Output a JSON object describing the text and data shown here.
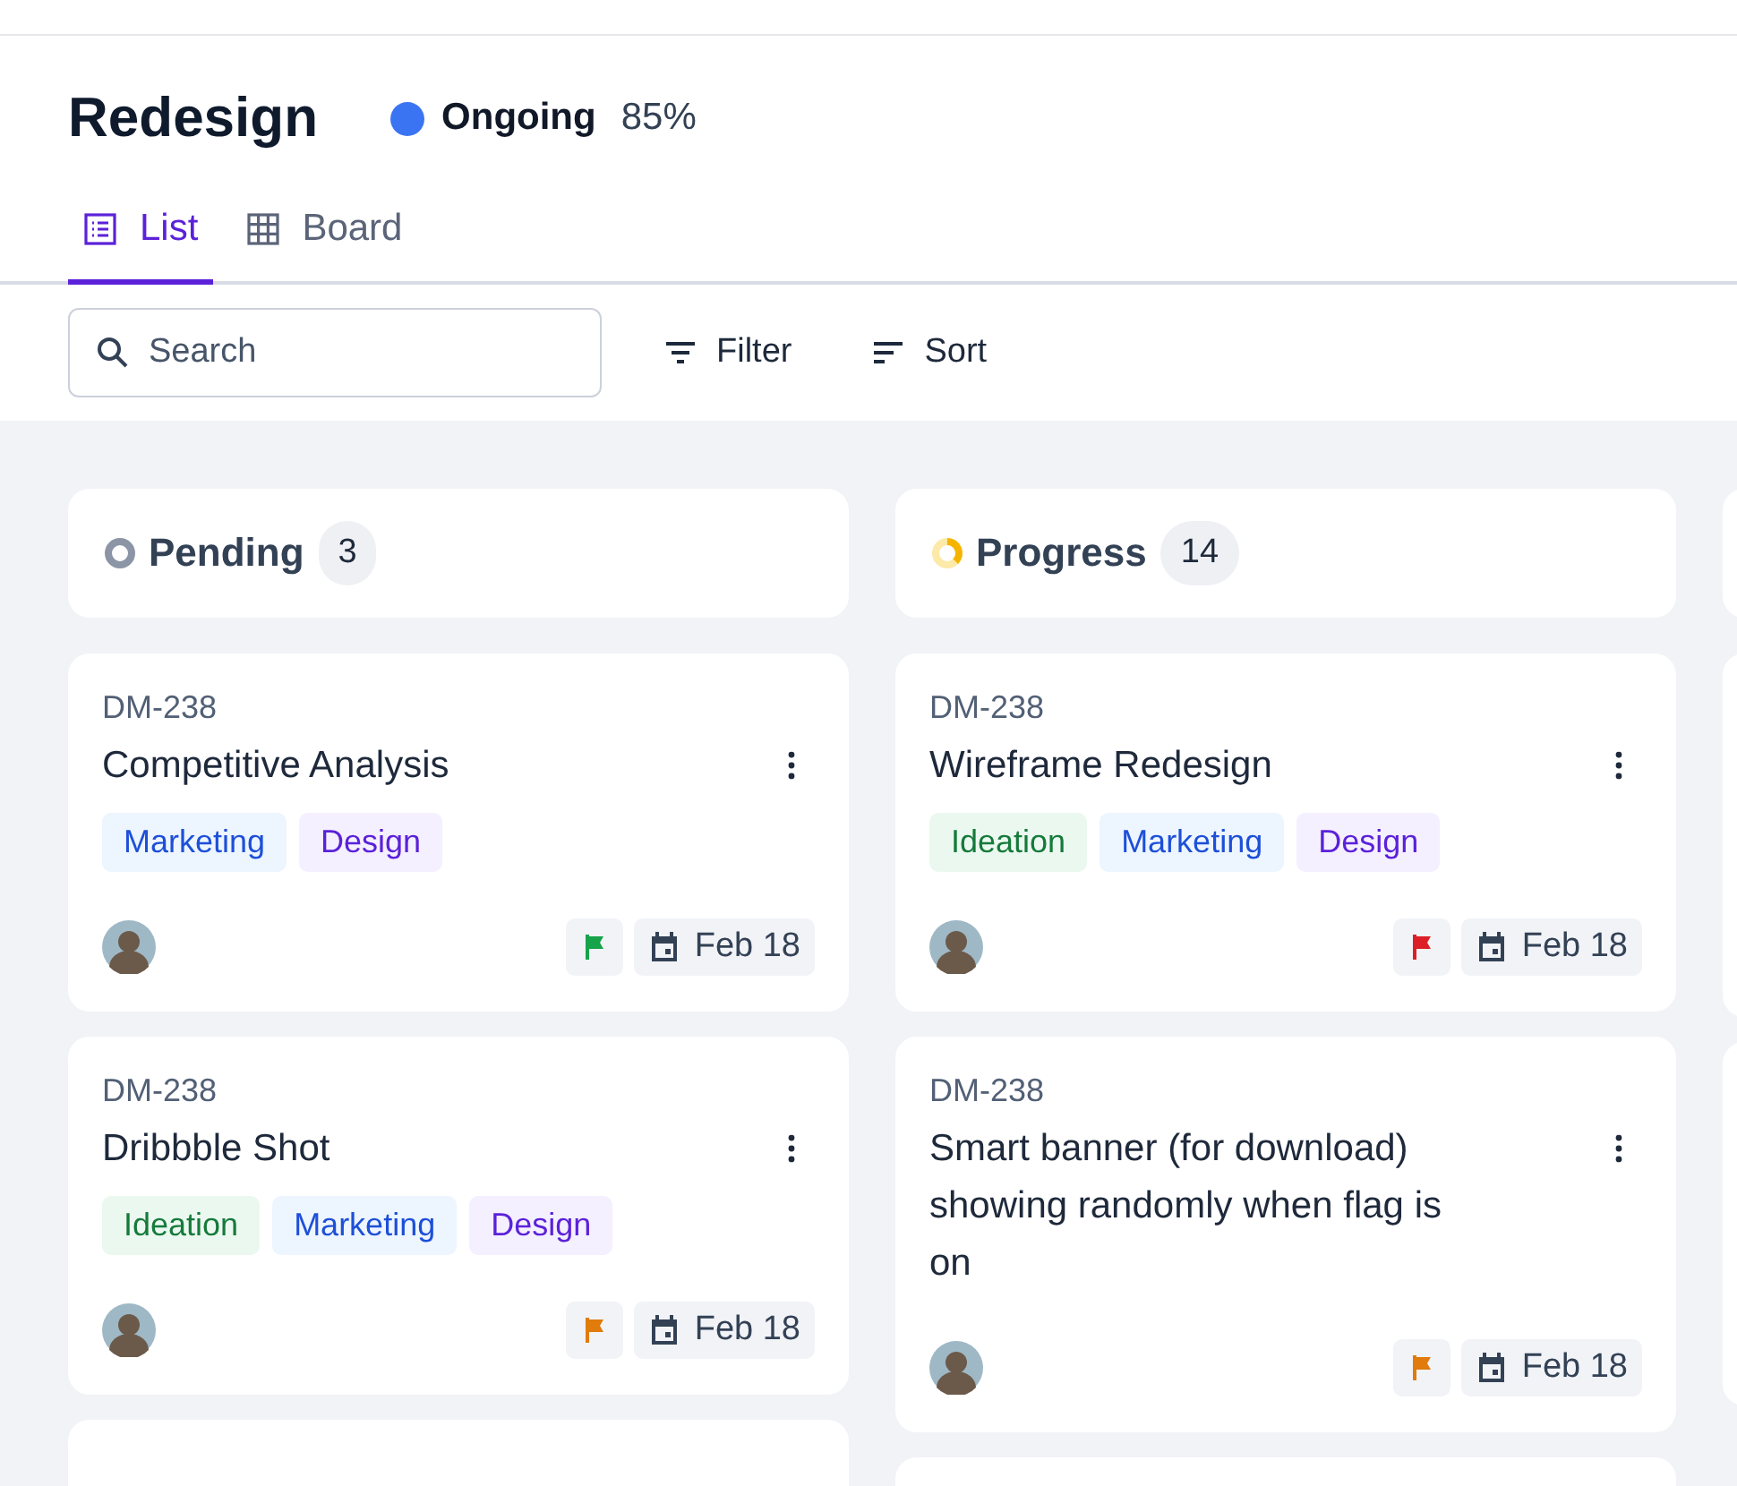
{
  "project": {
    "title": "Redesign",
    "status": {
      "label": "Ongoing",
      "color": "#3b74f2",
      "percent": "85%"
    }
  },
  "tabs": [
    {
      "label": "List",
      "kind": "list",
      "selected": true
    },
    {
      "label": "Board",
      "kind": "grid",
      "selected": false
    }
  ],
  "search": {
    "placeholder": "Search"
  },
  "toolbar": [
    {
      "label": "Filter",
      "kind": "filter"
    },
    {
      "label": "Sort",
      "kind": "sort"
    }
  ],
  "columns": [
    {
      "title": "Pending",
      "kind": "pending",
      "count": "3",
      "cards": [
        {
          "id": "DM-238",
          "title": "Competitive Analysis",
          "tags": [
            {
              "label": "Marketing",
              "kind": "marketing"
            },
            {
              "label": "Design",
              "kind": "design"
            }
          ],
          "flag": {
            "color": "#16a34a"
          },
          "date": "Feb 18"
        },
        {
          "id": "DM-238",
          "title": "Dribbble Shot",
          "tags": [
            {
              "label": "Ideation",
              "kind": "ideation"
            },
            {
              "label": "Marketing",
              "kind": "marketing"
            },
            {
              "label": "Design",
              "kind": "design"
            }
          ],
          "flag": {
            "color": "#e07b0c"
          },
          "date": "Feb 18"
        }
      ]
    },
    {
      "title": "Progress",
      "kind": "progress",
      "count": "14",
      "cards": [
        {
          "id": "DM-238",
          "title": "Wireframe Redesign",
          "tags": [
            {
              "label": "Ideation",
              "kind": "ideation"
            },
            {
              "label": "Marketing",
              "kind": "marketing"
            },
            {
              "label": "Design",
              "kind": "design"
            }
          ],
          "flag": {
            "color": "#dc1f26"
          },
          "date": "Feb 18"
        },
        {
          "id": "DM-238",
          "title": "Smart banner (for download) showing randomly when flag is on",
          "flag": {
            "color": "#e07b0c"
          },
          "date": "Feb 18"
        }
      ]
    }
  ]
}
